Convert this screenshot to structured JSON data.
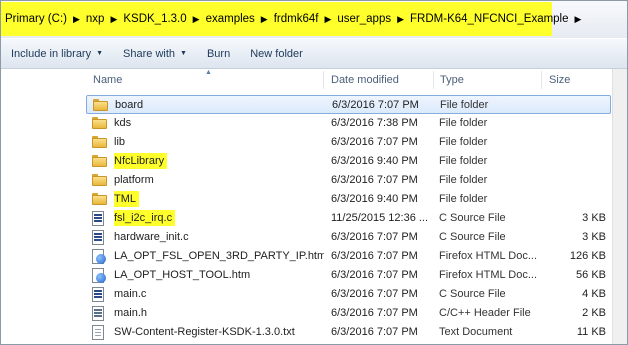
{
  "address_bar": {
    "crumbs": [
      "Primary (C:)",
      "nxp",
      "KSDK_1.3.0",
      "examples",
      "frdmk64f",
      "user_apps",
      "FRDM-K64_NFCNCI_Example"
    ],
    "highlight_color": "#ffff2b"
  },
  "toolbar": {
    "include_label": "Include in library",
    "share_label": "Share with",
    "burn_label": "Burn",
    "new_folder_label": "New folder"
  },
  "columns": {
    "name": "Name",
    "date": "Date modified",
    "type": "Type",
    "size": "Size"
  },
  "files": [
    {
      "name": "board",
      "date": "6/3/2016 7:07 PM",
      "type": "File folder",
      "size": "",
      "icon": "folder-icon",
      "selected": true,
      "highlighted": false
    },
    {
      "name": "kds",
      "date": "6/3/2016 7:38 PM",
      "type": "File folder",
      "size": "",
      "icon": "folder-icon",
      "selected": false,
      "highlighted": false
    },
    {
      "name": "lib",
      "date": "6/3/2016 7:07 PM",
      "type": "File folder",
      "size": "",
      "icon": "folder-icon",
      "selected": false,
      "highlighted": false
    },
    {
      "name": "NfcLibrary",
      "date": "6/3/2016 9:40 PM",
      "type": "File folder",
      "size": "",
      "icon": "folder-icon",
      "selected": false,
      "highlighted": true
    },
    {
      "name": "platform",
      "date": "6/3/2016 7:07 PM",
      "type": "File folder",
      "size": "",
      "icon": "folder-icon",
      "selected": false,
      "highlighted": false
    },
    {
      "name": "TML",
      "date": "6/3/2016 9:40 PM",
      "type": "File folder",
      "size": "",
      "icon": "folder-icon",
      "selected": false,
      "highlighted": true
    },
    {
      "name": "fsl_i2c_irq.c",
      "date": "11/25/2015 12:36 ...",
      "type": "C Source File",
      "size": "3 KB",
      "icon": "c-source-icon",
      "selected": false,
      "highlighted": true
    },
    {
      "name": "hardware_init.c",
      "date": "6/3/2016 7:07 PM",
      "type": "C Source File",
      "size": "3 KB",
      "icon": "c-source-icon",
      "selected": false,
      "highlighted": false
    },
    {
      "name": "LA_OPT_FSL_OPEN_3RD_PARTY_IP.htm",
      "date": "6/3/2016 7:07 PM",
      "type": "Firefox HTML Doc...",
      "size": "126 KB",
      "icon": "html-document-icon",
      "selected": false,
      "highlighted": false
    },
    {
      "name": "LA_OPT_HOST_TOOL.htm",
      "date": "6/3/2016 7:07 PM",
      "type": "Firefox HTML Doc...",
      "size": "56 KB",
      "icon": "html-document-icon",
      "selected": false,
      "highlighted": false
    },
    {
      "name": "main.c",
      "date": "6/3/2016 7:07 PM",
      "type": "C Source File",
      "size": "4 KB",
      "icon": "c-source-icon",
      "selected": false,
      "highlighted": false
    },
    {
      "name": "main.h",
      "date": "6/3/2016 7:07 PM",
      "type": "C/C++ Header File",
      "size": "2 KB",
      "icon": "c-header-icon",
      "selected": false,
      "highlighted": false
    },
    {
      "name": "SW-Content-Register-KSDK-1.3.0.txt",
      "date": "6/3/2016 7:07 PM",
      "type": "Text Document",
      "size": "11 KB",
      "icon": "text-document-icon",
      "selected": false,
      "highlighted": false
    }
  ]
}
